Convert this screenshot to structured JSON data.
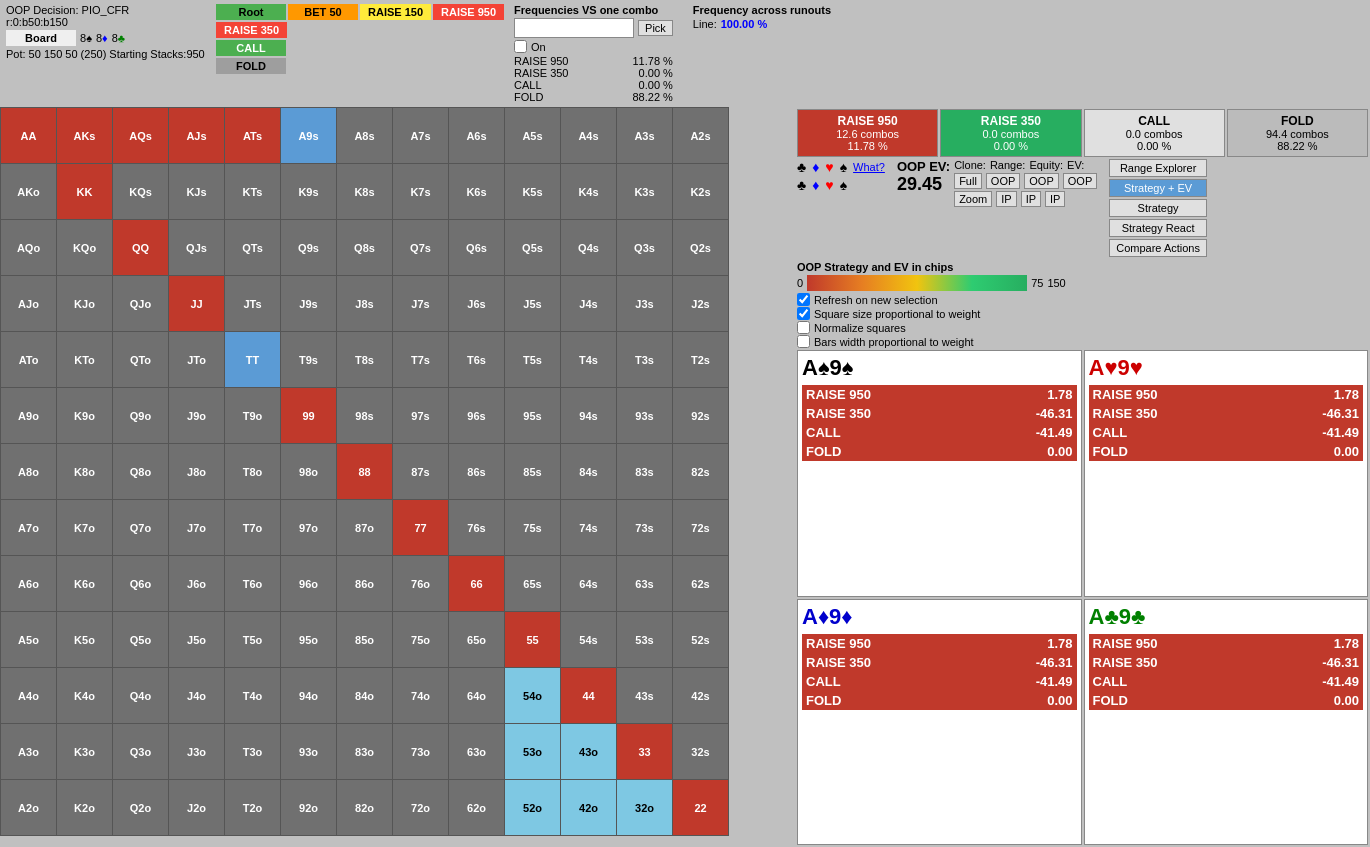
{
  "header": {
    "decision_title": "OOP Decision: PIO_CFR",
    "decision_sub": "r:0:b50:b150",
    "board_label": "Board",
    "board_cards": [
      "8♠",
      "8♦",
      "8♣"
    ],
    "pot_info": "Pot: 50 150 50 (250) Starting Stacks:950",
    "buttons": {
      "root": "Root",
      "bet50": "BET 50",
      "raise150": "RAISE 150",
      "raise950": "RAISE 950",
      "raise350": "RAISE 350",
      "call": "CALL",
      "fold": "FOLD"
    }
  },
  "frequencies": {
    "title": "Frequencies VS one combo",
    "freq_across": "Frequency across runouts",
    "line_label": "Line:",
    "line_val": "100.00 %",
    "on_label": "On",
    "actions": [
      {
        "label": "RAISE 950",
        "val": "11.78 %"
      },
      {
        "label": "RAISE 350",
        "val": "0.00 %"
      },
      {
        "label": "CALL",
        "val": "0.00 %"
      },
      {
        "label": "FOLD",
        "val": "88.22 %"
      }
    ]
  },
  "action_summary": [
    {
      "id": "raise950",
      "title": "RAISE 950",
      "combos": "12.6 combos",
      "pct": "11.78 %",
      "class": "box-raise950"
    },
    {
      "id": "raise350",
      "title": "RAISE 350",
      "combos": "0.0 combos",
      "pct": "0.00 %",
      "class": "box-raise350"
    },
    {
      "id": "call",
      "title": "CALL",
      "combos": "0.0 combos",
      "pct": "0.00 %",
      "class": "box-call"
    },
    {
      "id": "fold",
      "title": "FOLD",
      "combos": "94.4 combos",
      "pct": "88.22 %",
      "class": "box-fold"
    }
  ],
  "oop_ev": {
    "label": "OOP EV:",
    "value": "29.45"
  },
  "strategy_label": "OOP Strategy and EV in chips",
  "gradient": {
    "min": "0",
    "mid": "75",
    "max": "150"
  },
  "checkboxes": [
    {
      "label": "Refresh on new selection",
      "checked": true
    },
    {
      "label": "Square size proportional to weight",
      "checked": true
    },
    {
      "label": "Normalize squares",
      "checked": false
    },
    {
      "label": "Bars width proportional to weight",
      "checked": false
    }
  ],
  "clone_row": {
    "clone_label": "Clone:",
    "range_label": "Range:",
    "equity_label": "Equity:",
    "ev_label": "EV:"
  },
  "buttons_right": {
    "range_explorer": "Range Explorer",
    "strategy_ev": "Strategy + EV",
    "strategy": "Strategy",
    "strategy_react": "Strategy React",
    "compare_actions": "Compare Actions"
  },
  "zoom_ip_row": {
    "full": "Full",
    "oop": "OOP",
    "zoom": "Zoom",
    "ip": "IP"
  },
  "combos": [
    {
      "id": "as9s",
      "title_parts": [
        "A",
        "♠",
        "9",
        "♠"
      ],
      "suit": "spade",
      "actions": [
        {
          "label": "RAISE 950",
          "val": "1.78"
        },
        {
          "label": "RAISE 350",
          "val": "-46.31"
        },
        {
          "label": "CALL",
          "val": "-41.49"
        },
        {
          "label": "FOLD",
          "val": "0.00"
        }
      ]
    },
    {
      "id": "ah9h",
      "title_parts": [
        "A",
        "♥",
        "9",
        "♥"
      ],
      "suit": "heart",
      "actions": [
        {
          "label": "RAISE 950",
          "val": "1.78"
        },
        {
          "label": "RAISE 350",
          "val": "-46.31"
        },
        {
          "label": "CALL",
          "val": "-41.49"
        },
        {
          "label": "FOLD",
          "val": "0.00"
        }
      ]
    },
    {
      "id": "ad9d",
      "title_parts": [
        "A",
        "♦",
        "9",
        "♦"
      ],
      "suit": "diamond",
      "actions": [
        {
          "label": "RAISE 950",
          "val": "1.78"
        },
        {
          "label": "RAISE 350",
          "val": "-46.31"
        },
        {
          "label": "CALL",
          "val": "-41.49"
        },
        {
          "label": "FOLD",
          "val": "0.00"
        }
      ]
    },
    {
      "id": "ac9c",
      "title_parts": [
        "A",
        "♣",
        "9",
        "♣"
      ],
      "suit": "club",
      "actions": [
        {
          "label": "RAISE 950",
          "val": "1.78"
        },
        {
          "label": "RAISE 350",
          "val": "-46.31"
        },
        {
          "label": "CALL",
          "val": "-41.49"
        },
        {
          "label": "FOLD",
          "val": "0.00"
        }
      ]
    }
  ],
  "matrix": {
    "rows": [
      [
        "AA",
        "AKs",
        "AQs",
        "AJs",
        "ATs",
        "A9s",
        "A8s",
        "A7s",
        "A6s",
        "A5s",
        "A4s",
        "A3s",
        "A2s"
      ],
      [
        "AKo",
        "KK",
        "KQs",
        "KJs",
        "KTs",
        "K9s",
        "K8s",
        "K7s",
        "K6s",
        "K5s",
        "K4s",
        "K3s",
        "K2s"
      ],
      [
        "AQo",
        "KQo",
        "QQ",
        "QJs",
        "QTs",
        "Q9s",
        "Q8s",
        "Q7s",
        "Q6s",
        "Q5s",
        "Q4s",
        "Q3s",
        "Q2s"
      ],
      [
        "AJo",
        "KJo",
        "QJo",
        "JJ",
        "JTs",
        "J9s",
        "J8s",
        "J7s",
        "J6s",
        "J5s",
        "J4s",
        "J3s",
        "J2s"
      ],
      [
        "ATo",
        "KTo",
        "QTo",
        "JTo",
        "TT",
        "T9s",
        "T8s",
        "T7s",
        "T6s",
        "T5s",
        "T4s",
        "T3s",
        "T2s"
      ],
      [
        "A9o",
        "K9o",
        "Q9o",
        "J9o",
        "T9o",
        "99",
        "98s",
        "97s",
        "96s",
        "95s",
        "94s",
        "93s",
        "92s"
      ],
      [
        "A8o",
        "K8o",
        "Q8o",
        "J8o",
        "T8o",
        "98o",
        "88",
        "87s",
        "86s",
        "85s",
        "84s",
        "83s",
        "82s"
      ],
      [
        "A7o",
        "K7o",
        "Q7o",
        "J7o",
        "T7o",
        "97o",
        "87o",
        "77",
        "76s",
        "75s",
        "74s",
        "73s",
        "72s"
      ],
      [
        "A6o",
        "K6o",
        "Q6o",
        "J6o",
        "T6o",
        "96o",
        "86o",
        "76o",
        "66",
        "65s",
        "64s",
        "63s",
        "62s"
      ],
      [
        "A5o",
        "K5o",
        "Q5o",
        "J5o",
        "T5o",
        "95o",
        "85o",
        "75o",
        "65o",
        "55",
        "54s",
        "53s",
        "52s"
      ],
      [
        "A4o",
        "K4o",
        "Q4o",
        "J4o",
        "T4o",
        "94o",
        "84o",
        "74o",
        "64o",
        "54o",
        "44",
        "43s",
        "42s"
      ],
      [
        "A3o",
        "K3o",
        "Q3o",
        "J3o",
        "T3o",
        "93o",
        "83o",
        "73o",
        "63o",
        "53o",
        "43o",
        "33",
        "32s"
      ],
      [
        "A2o",
        "K2o",
        "Q2o",
        "J2o",
        "T2o",
        "92o",
        "82o",
        "72o",
        "62o",
        "52o",
        "42o",
        "32o",
        "22"
      ]
    ],
    "colors": [
      [
        "red",
        "red",
        "red",
        "red",
        "red",
        "blue",
        "gray",
        "gray",
        "gray",
        "gray",
        "gray",
        "gray",
        "gray"
      ],
      [
        "gray",
        "red",
        "gray",
        "gray",
        "gray",
        "gray",
        "gray",
        "gray",
        "gray",
        "gray",
        "gray",
        "gray",
        "gray"
      ],
      [
        "gray",
        "gray",
        "red",
        "gray",
        "gray",
        "gray",
        "gray",
        "gray",
        "gray",
        "gray",
        "gray",
        "gray",
        "gray"
      ],
      [
        "gray",
        "gray",
        "gray",
        "red",
        "gray",
        "gray",
        "gray",
        "gray",
        "gray",
        "gray",
        "gray",
        "gray",
        "gray"
      ],
      [
        "gray",
        "gray",
        "gray",
        "gray",
        "blue",
        "gray",
        "gray",
        "gray",
        "gray",
        "gray",
        "gray",
        "gray",
        "gray"
      ],
      [
        "gray",
        "gray",
        "gray",
        "gray",
        "gray",
        "red",
        "gray",
        "gray",
        "gray",
        "gray",
        "gray",
        "gray",
        "gray"
      ],
      [
        "gray",
        "gray",
        "gray",
        "gray",
        "gray",
        "gray",
        "red",
        "gray",
        "gray",
        "gray",
        "gray",
        "gray",
        "gray"
      ],
      [
        "gray",
        "gray",
        "gray",
        "gray",
        "gray",
        "gray",
        "gray",
        "red",
        "gray",
        "gray",
        "gray",
        "gray",
        "gray"
      ],
      [
        "gray",
        "gray",
        "gray",
        "gray",
        "gray",
        "gray",
        "gray",
        "gray",
        "red",
        "gray",
        "gray",
        "gray",
        "gray"
      ],
      [
        "gray",
        "gray",
        "gray",
        "gray",
        "gray",
        "gray",
        "gray",
        "gray",
        "gray",
        "red",
        "gray",
        "gray",
        "gray"
      ],
      [
        "gray",
        "gray",
        "gray",
        "gray",
        "gray",
        "gray",
        "gray",
        "gray",
        "gray",
        "highlight",
        "red",
        "gray",
        "gray"
      ],
      [
        "gray",
        "gray",
        "gray",
        "gray",
        "gray",
        "gray",
        "gray",
        "gray",
        "gray",
        "highlight",
        "highlight",
        "red",
        "gray"
      ],
      [
        "gray",
        "gray",
        "gray",
        "gray",
        "gray",
        "gray",
        "gray",
        "gray",
        "gray",
        "highlight",
        "highlight",
        "highlight",
        "red"
      ]
    ]
  }
}
